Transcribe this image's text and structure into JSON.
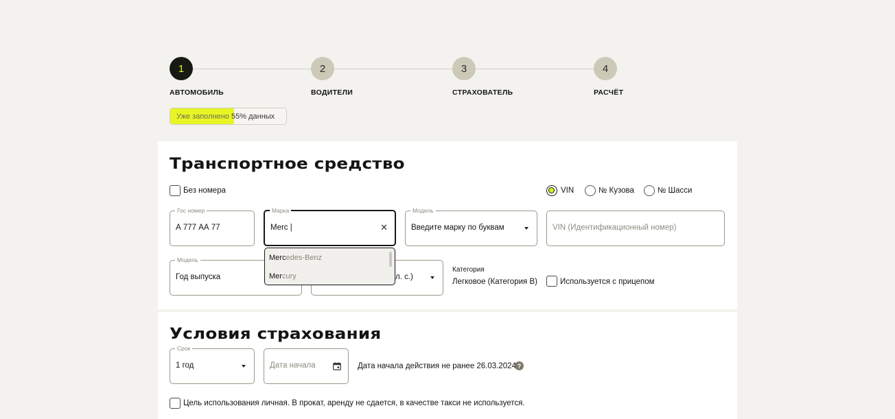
{
  "stepper": {
    "steps": [
      {
        "number": "1",
        "label": "АВТОМОБИЛЬ"
      },
      {
        "number": "2",
        "label": "ВОДИТЕЛИ"
      },
      {
        "number": "3",
        "label": "СТРАХОВАТЕЛЬ"
      },
      {
        "number": "4",
        "label": "РАСЧЁТ"
      }
    ],
    "active_step": 1
  },
  "progress": {
    "prefix": "Уже заполнено ",
    "value_text": "55% данных",
    "percent": 55
  },
  "vehicle": {
    "title": "Транспортное средство",
    "no_plate_label": "Без номера",
    "id_options": [
      "VIN",
      "№ Кузова",
      "№ Шасси"
    ],
    "id_selected": "VIN",
    "plate": {
      "legend": "Гос номер",
      "value": "А 777 АА 77"
    },
    "brand": {
      "legend": "Марка",
      "value": "Merc |"
    },
    "model": {
      "legend": "Модель",
      "value": "Введите марку по буквам"
    },
    "vin": {
      "placeholder": "VIN (Идентификационный номер)"
    },
    "year": {
      "legend": "Модель",
      "value": "Год выпуска"
    },
    "power": {
      "value_fragment": "л. с.)"
    },
    "category": {
      "label": "Категория",
      "value": "Легковое (Категория B)"
    },
    "trailer_label": "Используется с прицепом",
    "brand_suggestions": [
      {
        "match": "Merc",
        "rest": "edes-Benz"
      },
      {
        "match": "Mer",
        "rest": "cury"
      }
    ]
  },
  "insurance": {
    "title": "Условия страхования",
    "term": {
      "legend": "Срок",
      "value": "1 год"
    },
    "start_date": {
      "placeholder": "Дата начала"
    },
    "start_note": "Дата начала действия не ранее 26.03.2024",
    "help": "?",
    "purpose_label": "Цель использования личная. В прокат, аренду не сдается, в качестве такси не используется."
  },
  "colors": {
    "accent": "#e8f525",
    "dark": "#161a12",
    "step_inactive": "#cdc9b8",
    "background": "#f3f2ef"
  }
}
